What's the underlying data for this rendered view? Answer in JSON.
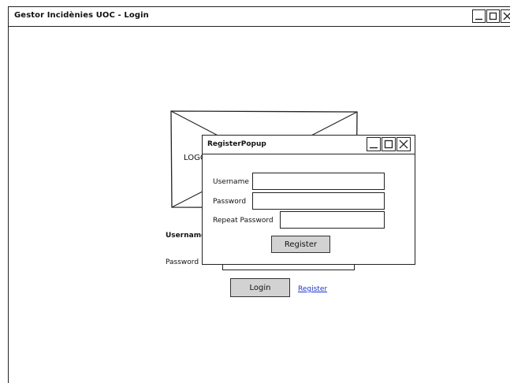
{
  "window": {
    "title": "Gestor Incidènies UOC - Login"
  },
  "logo": {
    "label": "LOGO"
  },
  "form": {
    "username_label": "Username",
    "password_label": "Password",
    "login_button": "Login",
    "register_link": "Register"
  },
  "popup": {
    "title": "RegisterPopup",
    "username_label": "Username",
    "password_label": "Password",
    "repeat_password_label": "Repeat Password",
    "username_value": "",
    "password_value": "",
    "repeat_password_value": "",
    "register_button": "Register"
  },
  "icons": {
    "minimize": "minimize-icon",
    "maximize": "maximize-icon",
    "close": "close-icon"
  }
}
